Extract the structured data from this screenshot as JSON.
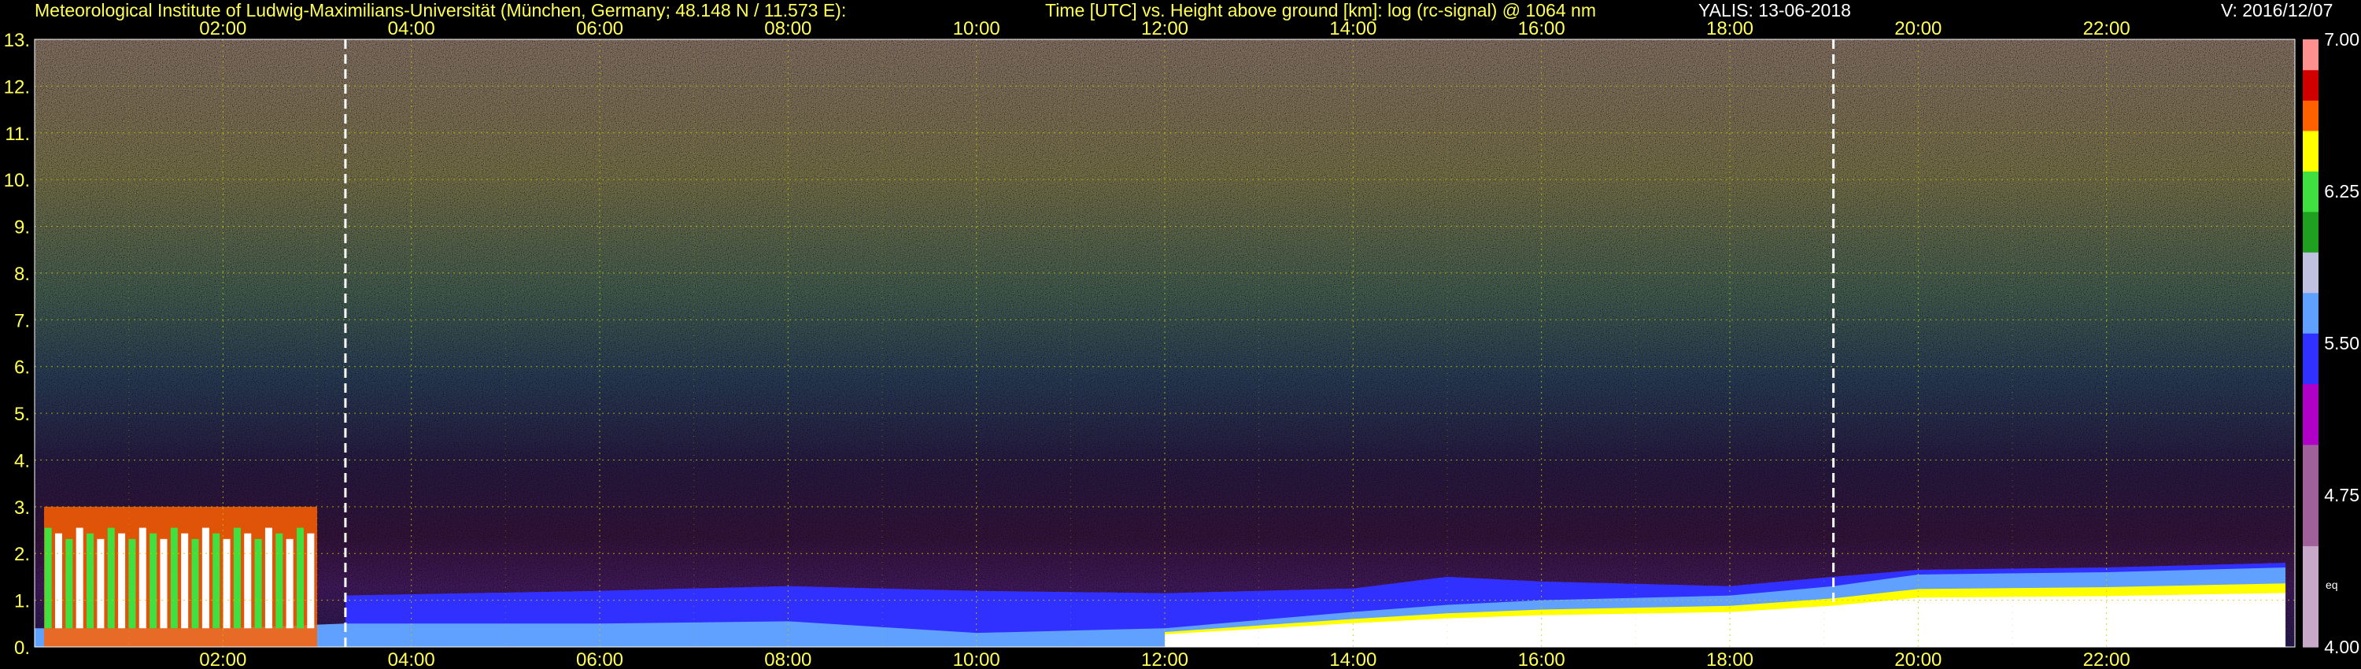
{
  "header": {
    "institute": "Meteorological Institute of Ludwig-Maximilians-Universität (München, Germany; 48.148 N / 11.573 E):",
    "plot_title": "Time [UTC] vs. Height above ground [km]: log (rc-signal) @ 1064 nm",
    "instrument": "YALIS: 13-06-2018",
    "version": "V: 2016/12/07"
  },
  "colors": {
    "background": "#000000",
    "text": "#ffff55",
    "grid": "#c8c800",
    "marker": "#ffffff"
  },
  "chart_data": {
    "type": "heatmap",
    "title": "Time [UTC] vs. Height above ground [km]: log (rc-signal) @ 1064 nm",
    "x_unit": "hours UTC",
    "xlim": [
      0,
      24
    ],
    "x_ticks": [
      2,
      4,
      6,
      8,
      10,
      12,
      14,
      16,
      18,
      20,
      22
    ],
    "x_tick_labels": [
      "02:00",
      "04:00",
      "06:00",
      "08:00",
      "10:00",
      "12:00",
      "14:00",
      "16:00",
      "18:00",
      "20:00",
      "22:00"
    ],
    "y_unit": "km",
    "ylim": [
      0,
      13
    ],
    "y_ticks": [
      0,
      1,
      2,
      3,
      4,
      5,
      6,
      7,
      8,
      9,
      10,
      11,
      12,
      13
    ],
    "y_tick_labels": [
      "0.",
      "1.",
      "2.",
      "3.",
      "4.",
      "5.",
      "6.",
      "7.",
      "8.",
      "9.",
      "10.",
      "11.",
      "12.",
      "13."
    ],
    "grid": true,
    "vertical_markers_hours": [
      3.3,
      19.1
    ],
    "colorbar": {
      "range": [
        4.0,
        7.0
      ],
      "tick_values": [
        7.0,
        6.25,
        5.5,
        4.75,
        4.0
      ],
      "tick_labels": [
        "7.00",
        "6.25",
        "5.50",
        "4.75",
        "4.00"
      ],
      "extra_label": "eq",
      "stops": [
        {
          "value": 4.0,
          "color": "#c8a8c8"
        },
        {
          "value": 4.5,
          "color": "#a0609a"
        },
        {
          "value": 5.0,
          "color": "#b000c8"
        },
        {
          "value": 5.3,
          "color": "#3030ff"
        },
        {
          "value": 5.55,
          "color": "#60a0ff"
        },
        {
          "value": 5.75,
          "color": "#c0c0e0"
        },
        {
          "value": 5.95,
          "color": "#20a020"
        },
        {
          "value": 6.15,
          "color": "#40e040"
        },
        {
          "value": 6.35,
          "color": "#ffff00"
        },
        {
          "value": 6.55,
          "color": "#ff6000"
        },
        {
          "value": 6.7,
          "color": "#d00000"
        },
        {
          "value": 6.85,
          "color": "#ff9090"
        },
        {
          "value": 7.0,
          "color": "#ffffff"
        }
      ]
    },
    "aerosol_layer_top_km": {
      "hours": [
        0,
        2,
        3.3,
        6,
        8,
        10,
        12,
        14,
        15,
        16,
        18,
        19.1,
        20,
        22,
        23.9
      ],
      "height": [
        0.4,
        0.4,
        0.5,
        0.5,
        0.55,
        0.3,
        0.4,
        0.75,
        0.9,
        1.0,
        1.1,
        1.3,
        1.55,
        1.6,
        1.7
      ]
    },
    "residual_layer_top_km": {
      "hours": [
        3.3,
        6,
        8,
        10,
        12,
        14,
        15,
        16,
        18,
        19.1,
        20,
        22,
        23.9
      ],
      "height": [
        1.1,
        1.2,
        1.3,
        1.2,
        1.15,
        1.25,
        1.5,
        1.4,
        1.3,
        1.5,
        1.65,
        1.7,
        1.8
      ]
    },
    "low_cloud_top_km": {
      "hours": [
        0.1,
        3.0
      ],
      "height": [
        3.0,
        3.0
      ]
    }
  }
}
